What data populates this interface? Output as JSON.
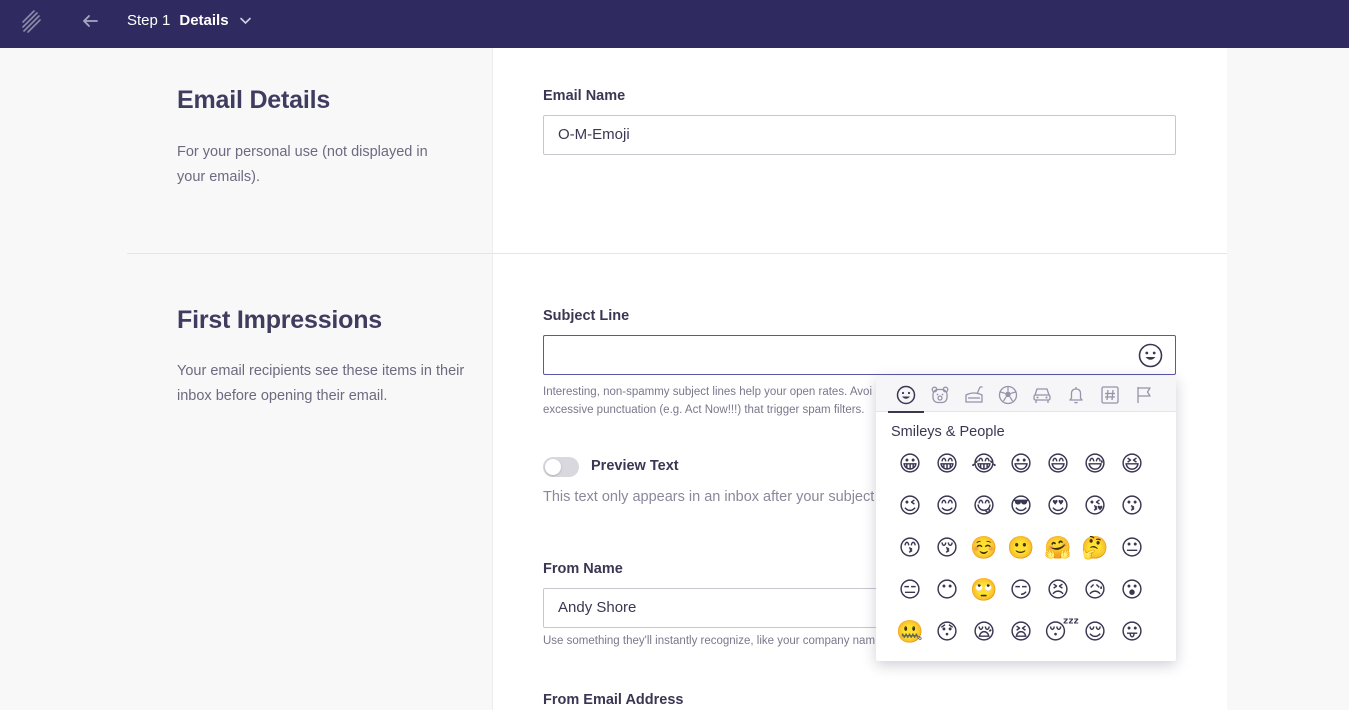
{
  "topbar": {
    "step_number": "Step 1",
    "step_name": "Details"
  },
  "email_details": {
    "title": "Email Details",
    "description": "For your personal use (not displayed in your emails).",
    "email_name_label": "Email Name",
    "email_name_value": "O-M-Emoji"
  },
  "first_impressions": {
    "title": "First Impressions",
    "description": "Your email recipients see these items in their inbox before opening their email.",
    "subject_label": "Subject Line",
    "subject_value": "",
    "subject_help_1": "Interesting, non-spammy subject lines help your open rates. Avoi",
    "subject_help_2": "excessive punctuation (e.g. Act Now!!!) that trigger spam filters.",
    "preview_label": "Preview Text",
    "preview_desc": "This text only appears in an inbox after your subject",
    "from_name_label": "From Name",
    "from_name_value": "Andy Shore",
    "from_name_help": "Use something they'll instantly recognize, like your company nam",
    "from_email_label": "From Email Address"
  },
  "emoji_picker": {
    "tabs": [
      "smileys-icon",
      "animals-icon",
      "food-icon",
      "activity-icon",
      "travel-icon",
      "objects-icon",
      "symbols-icon",
      "flags-icon"
    ],
    "category": "Smileys & People",
    "emojis": [
      "😀",
      "😁",
      "😂",
      "😃",
      "😄",
      "😅",
      "😆",
      "😉",
      "😊",
      "😋",
      "😎",
      "😍",
      "😘",
      "😗",
      "😙",
      "😚",
      "☺️",
      "🙂",
      "🤗",
      "🤔",
      "😐",
      "😑",
      "😶",
      "🙄",
      "😏",
      "😣",
      "😥",
      "😮",
      "🤐",
      "😯",
      "😪",
      "😫",
      "😴",
      "😌",
      "😛"
    ]
  },
  "colors": {
    "topbar": "#2f2b60",
    "text": "#3a3752",
    "focus_border": "#5a57a8"
  }
}
